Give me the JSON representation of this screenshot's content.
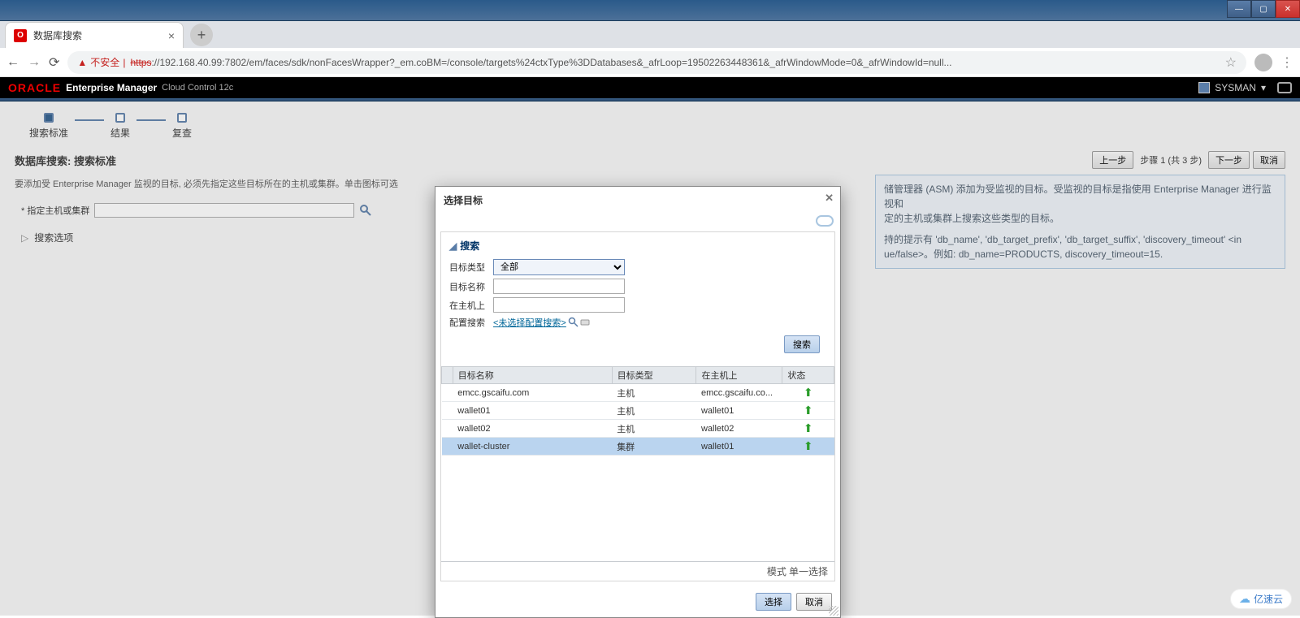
{
  "browser": {
    "tab_title": "数据库搜索",
    "insecure": "不安全",
    "url_scheme": "https",
    "url_rest": "://192.168.40.99:7802/em/faces/sdk/nonFacesWrapper?_em.coBM=/console/targets%24ctxType%3DDatabases&_afrLoop=19502263448361&_afrWindowMode=0&_afrWindowId=null...",
    "user": "SYSMAN",
    "win_min": "—",
    "win_max": "▢",
    "win_close": "✕"
  },
  "header": {
    "logo": "ORACLE",
    "title": "Enterprise Manager",
    "subtitle": "Cloud Control 12c"
  },
  "train": {
    "step1": "搜索标准",
    "step2": "结果",
    "step3": "复查"
  },
  "page": {
    "title": "数据库搜索: 搜索标准",
    "prev": "上一步",
    "step_label": "步骤 1 (共 3 步)",
    "next": "下一步",
    "cancel": "取消",
    "desc": "要添加受 Enterprise Manager 监视的目标, 必须先指定这些目标所在的主机或集群。单击图标可选",
    "host_label": "* 指定主机或集群",
    "expand": "搜索选项"
  },
  "info": {
    "line1_tail": "储管理器 (ASM) 添加为受监视的目标。受监视的目标是指使用 Enterprise Manager 进行监视和",
    "line2_tail": "定的主机或集群上搜索这些类型的目标。",
    "line3_tail": "持的提示有 'db_name', 'db_target_prefix', 'db_target_suffix', 'discovery_timeout' <in",
    "line4_tail": "ue/false>。例如: db_name=PRODUCTS, discovery_timeout=15."
  },
  "modal": {
    "title": "选择目标",
    "search_header": "搜索",
    "target_type_label": "目标类型",
    "target_type_value": "全部",
    "target_name_label": "目标名称",
    "on_host_label": "在主机上",
    "config_search_label": "配置搜索",
    "config_search_link": "<未选择配置搜索>",
    "search_btn": "搜索",
    "cols": {
      "name": "目标名称",
      "type": "目标类型",
      "host": "在主机上",
      "status": "状态"
    },
    "rows": [
      {
        "name": "emcc.gscaifu.com",
        "type": "主机",
        "host": "emcc.gscaifu.co...",
        "selected": false
      },
      {
        "name": "wallet01",
        "type": "主机",
        "host": "wallet01",
        "selected": false
      },
      {
        "name": "wallet02",
        "type": "主机",
        "host": "wallet02",
        "selected": false
      },
      {
        "name": "wallet-cluster",
        "type": "集群",
        "host": "wallet01",
        "selected": true
      }
    ],
    "mode_label": "模式",
    "mode_value": "单一选择",
    "select_btn": "选择",
    "cancel_btn": "取消"
  },
  "watermark": "亿速云"
}
